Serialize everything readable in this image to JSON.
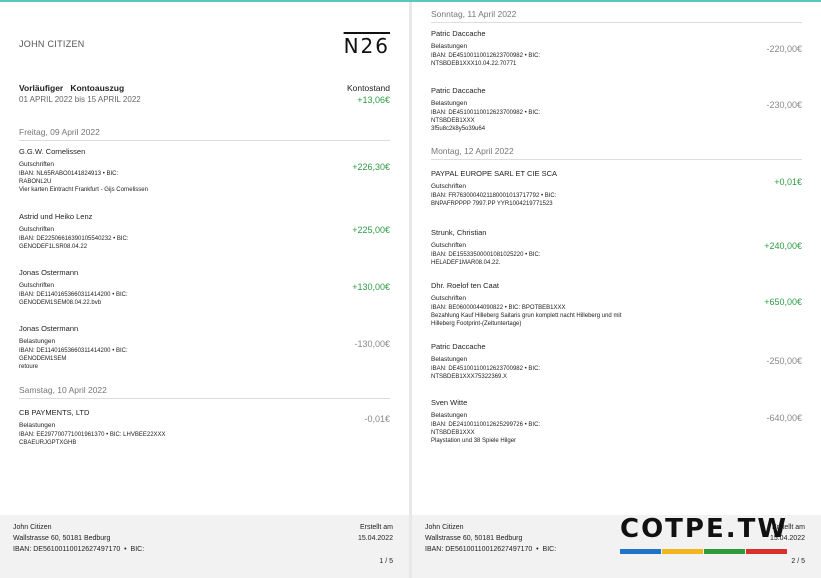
{
  "page1": {
    "holder": "JOHN CITIZEN",
    "logo": "N26",
    "title": "Vorläufiger   Kontoauszug",
    "range": "01 APRIL 2022 bis 15 APRIL 2022",
    "balance_label": "Kontostand",
    "balance_value": "+13,06€",
    "days": [
      {
        "label": "Freitag, 09 April 2022"
      },
      {
        "label": "Samstag, 10 April 2022"
      }
    ],
    "transactions": [
      {
        "name": "G.G.W. Cornelissen",
        "type": "Gutschriften",
        "lines": [
          "IBAN: NL65RABO0141824913 • BIC:",
          "RABONL2U",
          "Vier karten Eintracht Frankfurt - Gijs Cornelissen"
        ],
        "amount": "+226,30€"
      },
      {
        "name": "Astrid und Heiko Lenz",
        "type": "Gutschriften",
        "lines": [
          "IBAN: DE22506616390105540232 • BIC:",
          "GENODEF1LSR08.04.22"
        ],
        "amount": "+225,00€"
      },
      {
        "name": "Jonas Ostermann",
        "type": "Gutschriften",
        "lines": [
          "IBAN: DE11401653660311414200 • BIC:",
          "GENODEM1SEM08.04.22.bvb"
        ],
        "amount": "+130,00€"
      },
      {
        "name": "Jonas Ostermann",
        "type": "Belastungen",
        "lines": [
          "IBAN: DE11401653660311414200 • BIC:",
          "GENODEM1SEM",
          "retoure"
        ],
        "amount": "-130,00€"
      },
      {
        "name": "CB PAYMENTS, LTD",
        "type": "Belastungen",
        "lines": [
          "IBAN: EE297700771001961370 • BIC: LHVBEE22XXX",
          "CBAEURJGPTXGHB"
        ],
        "amount": "-0,01€"
      }
    ],
    "footer": {
      "name": "John Citizen",
      "address": "Wallstrasse 60, 50181 Bedburg",
      "iban": "IBAN: DE56100110012627497170  •  BIC:",
      "created_label": "Erstellt am",
      "created_date": "15.04.2022",
      "page": "1 / 5"
    }
  },
  "page2": {
    "days": [
      {
        "label": "Sonntag, 11 April 2022"
      },
      {
        "label": "Montag, 12 April 2022"
      }
    ],
    "transactions": [
      {
        "name": "Patric Daccache",
        "type": "Belastungen",
        "lines": [
          "IBAN: DE45100110012623700982 • BIC:",
          "NTSBDEB1XXX10.04.22.70771"
        ],
        "amount": "-220,00€"
      },
      {
        "name": "Patric Daccache",
        "type": "Belastungen",
        "lines": [
          "IBAN: DE45100110012623700982 • BIC:",
          "NTSBDEB1XXX",
          "3f5u8c2k8y5o39u64"
        ],
        "amount": "-230,00€"
      },
      {
        "name": "PAYPAL EUROPE SARL ET CIE SCA",
        "type": "Gutschriften",
        "lines": [
          "IBAN: FR7630004021180001013717792 • BIC:",
          "BNPAFRPPPP 7997.PP YYR1004219771523"
        ],
        "amount": "+0,01€"
      },
      {
        "name": "Strunk, Christian",
        "type": "Gutschriften",
        "lines": [
          "IBAN: DE15533500001081025220 • BIC:",
          "HELADEF1MAR08.04.22."
        ],
        "amount": "+240,00€"
      },
      {
        "name": "Dhr. Roelof ten Caat",
        "type": "Gutschriften",
        "lines": [
          "IBAN: BE06000044090822 • BIC: BPOTBEB1XXX",
          "Bezahlung Kauf Hilleberg Saitaris grun komplett nacht Hilleberg und mit",
          "Hilleberg Footprint-(Zeltuntertage)"
        ],
        "amount": "+650,00€"
      },
      {
        "name": "Patric Daccache",
        "type": "Belastungen",
        "lines": [
          "IBAN: DE45100110012623700982 • BIC:",
          "NTSBDEB1XXX75322369.X"
        ],
        "amount": "-250,00€"
      },
      {
        "name": "Sven Witte",
        "type": "Belastungen",
        "lines": [
          "IBAN: DE24100110012625299726 • BIC:",
          "NTSBDEB1XXX",
          "Playstation und 38 Spiele Hilger"
        ],
        "amount": "-640,00€"
      }
    ],
    "footer": {
      "name": "John Citizen",
      "address": "Wallstrasse 60, 50181 Bedburg",
      "iban": "IBAN: DE56100110012627497170  •  BIC:",
      "created_label": "Erstellt am",
      "created_date": "15.04.2022",
      "page": "2 / 5"
    }
  },
  "watermark": {
    "text": "COTPE.TW",
    "bar_colors": [
      "#1f74c7",
      "#f2b51d",
      "#2f9a3b",
      "#d9302c"
    ]
  }
}
